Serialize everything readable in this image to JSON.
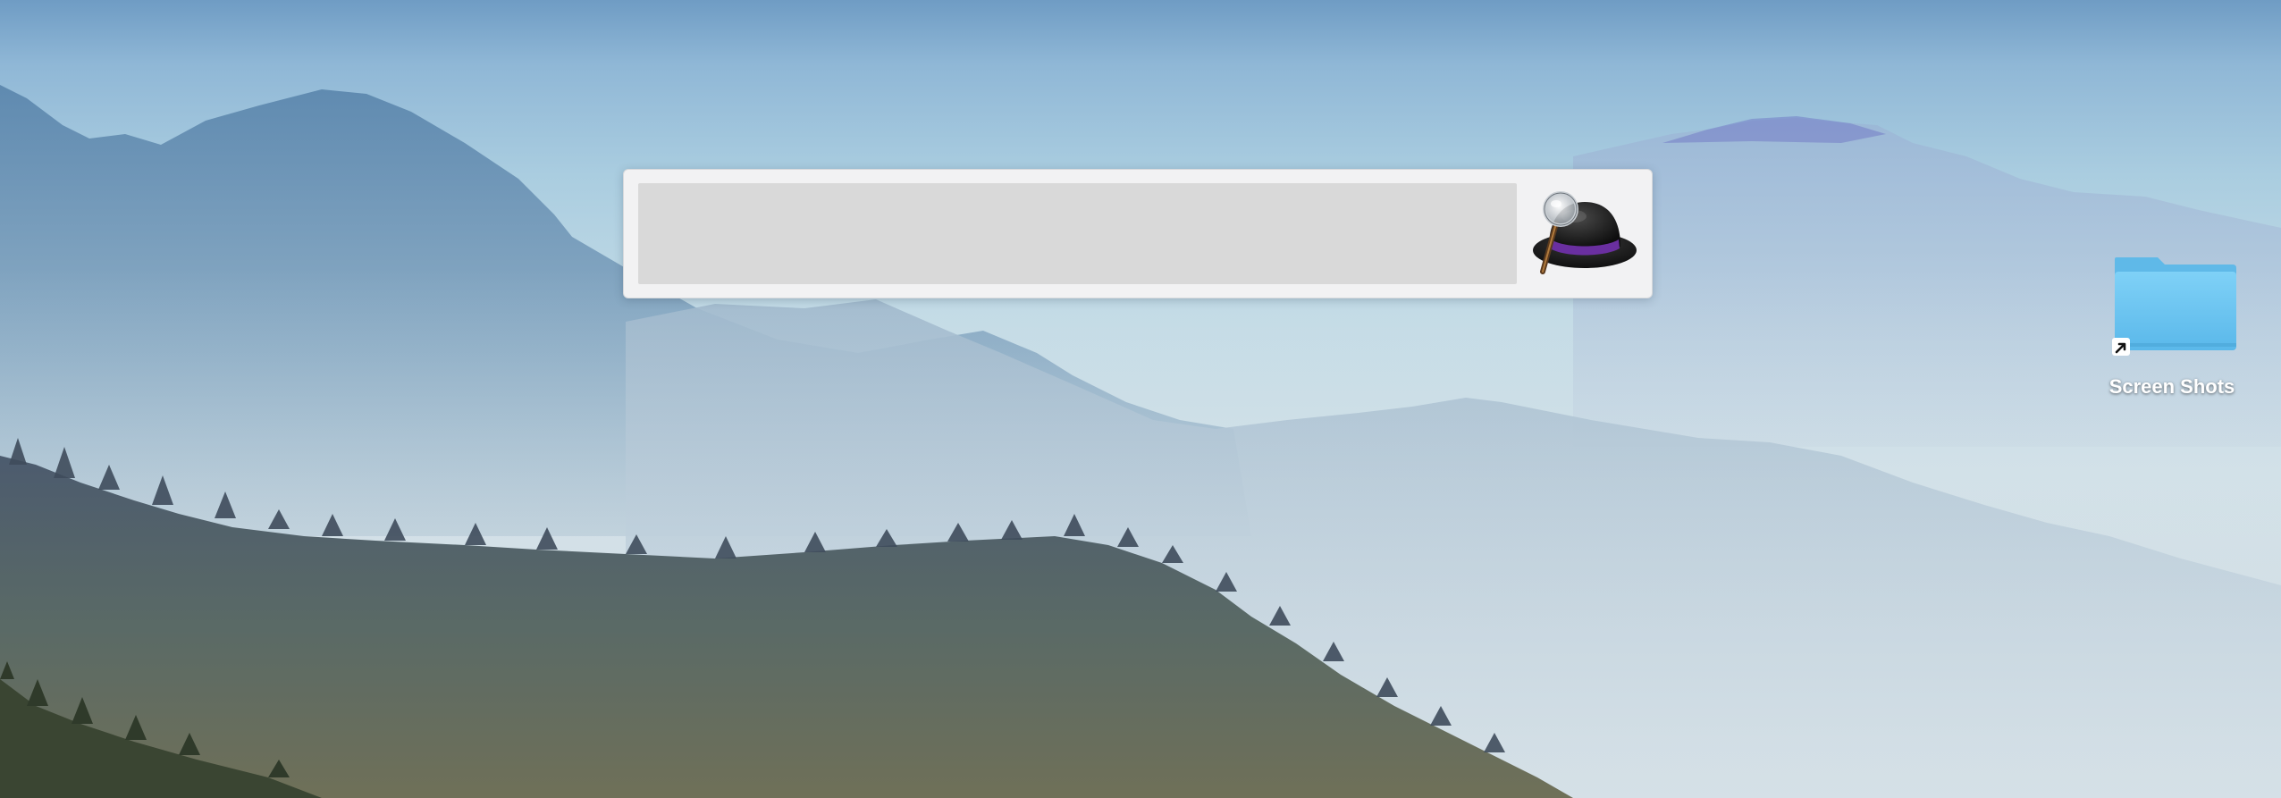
{
  "launcher": {
    "query": "",
    "placeholder": "",
    "logo_icon": "alfred-hat-magnifier-icon"
  },
  "desktop": {
    "items": [
      {
        "label": "Screen Shots",
        "icon": "folder-alias-icon"
      }
    ]
  },
  "colors": {
    "folder_blue": "#6cc6f3",
    "hat_band_purple": "#6a2fa0",
    "panel_bg": "#f2f2f3",
    "input_bg": "#d9d9d9"
  }
}
